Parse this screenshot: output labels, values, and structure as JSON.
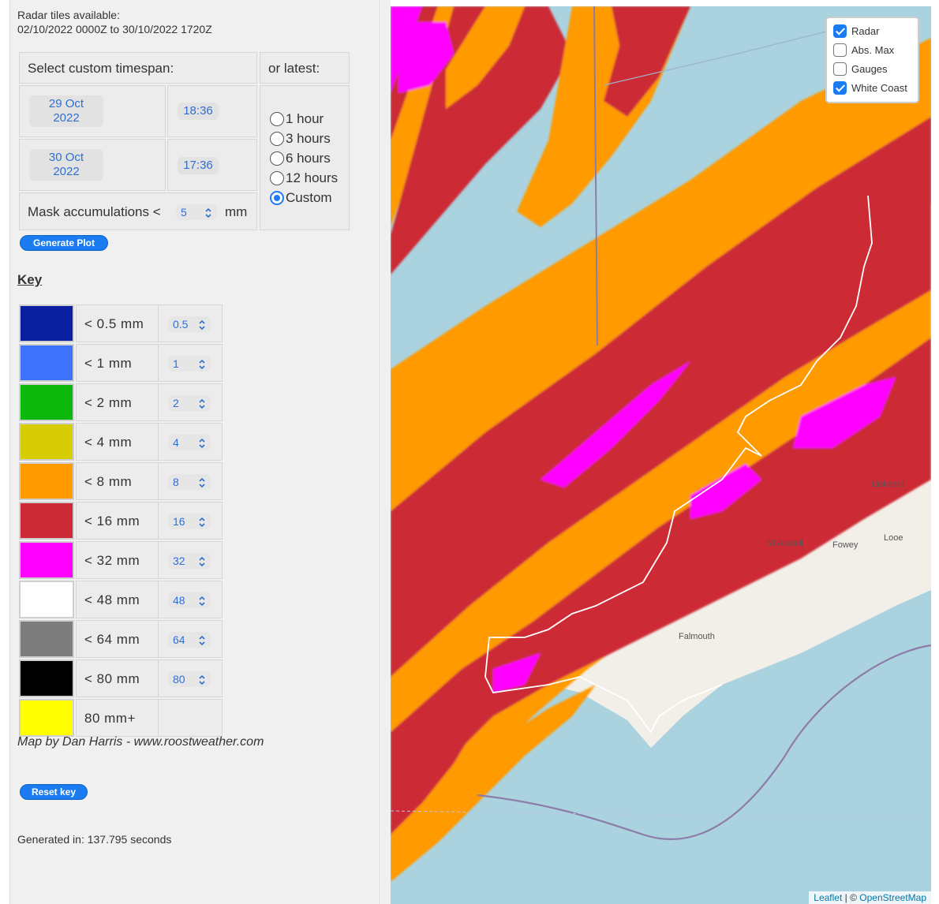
{
  "info": {
    "line1": "Radar tiles available:",
    "line2": "02/10/2022 0000Z to 30/10/2022 1720Z"
  },
  "timespan": {
    "header": "Select custom timespan:",
    "latest_header": "or latest:",
    "start_date_line1": "29 Oct",
    "start_date_line2": "2022",
    "start_time": "18:36",
    "end_date_line1": "30 Oct",
    "end_date_line2": "2022",
    "end_time": "17:36",
    "mask_label": "Mask accumulations <",
    "mask_value": "5",
    "mask_unit": "mm"
  },
  "latest_options": [
    {
      "label": "1 hour",
      "selected": false
    },
    {
      "label": "3 hours",
      "selected": false
    },
    {
      "label": "6 hours",
      "selected": false
    },
    {
      "label": "12 hours",
      "selected": false
    },
    {
      "label": "Custom",
      "selected": true
    }
  ],
  "generate_button": "Generate Plot",
  "key": {
    "title": "Key",
    "rows": [
      {
        "label": "< 0.5 mm",
        "value": "0.5",
        "color": "#0a1fa0"
      },
      {
        "label": "< 1 mm",
        "value": "1",
        "color": "#3d73fb"
      },
      {
        "label": "< 2 mm",
        "value": "2",
        "color": "#0bb80b"
      },
      {
        "label": "< 4 mm",
        "value": "4",
        "color": "#d8cc05"
      },
      {
        "label": "< 8 mm",
        "value": "8",
        "color": "#ff9a00"
      },
      {
        "label": "< 16 mm",
        "value": "16",
        "color": "#cc2b36"
      },
      {
        "label": "< 32 mm",
        "value": "32",
        "color": "#ff00ff"
      },
      {
        "label": "< 48 mm",
        "value": "48",
        "color": "#ffffff"
      },
      {
        "label": "< 64 mm",
        "value": "64",
        "color": "#7d7d7d"
      },
      {
        "label": "< 80 mm",
        "value": "80",
        "color": "#000000"
      },
      {
        "label": "80 mm+",
        "value": "",
        "color": "#ffff00"
      }
    ]
  },
  "credit": "Map by Dan Harris - www.roostweather.com",
  "reset_button": "Reset key",
  "generated": "Generated in: 137.795 seconds",
  "map": {
    "layers": [
      {
        "label": "Radar",
        "checked": true
      },
      {
        "label": "Abs. Max",
        "checked": false
      },
      {
        "label": "Gauges",
        "checked": false
      },
      {
        "label": "White Coast",
        "checked": true
      }
    ],
    "places": [
      "Liskeard",
      "Looe",
      "St Austell",
      "Fowey",
      "Falmouth"
    ],
    "attribution_leaflet": "Leaflet",
    "attribution_sep": "| ©",
    "attribution_osm": "OpenStreetMap"
  }
}
